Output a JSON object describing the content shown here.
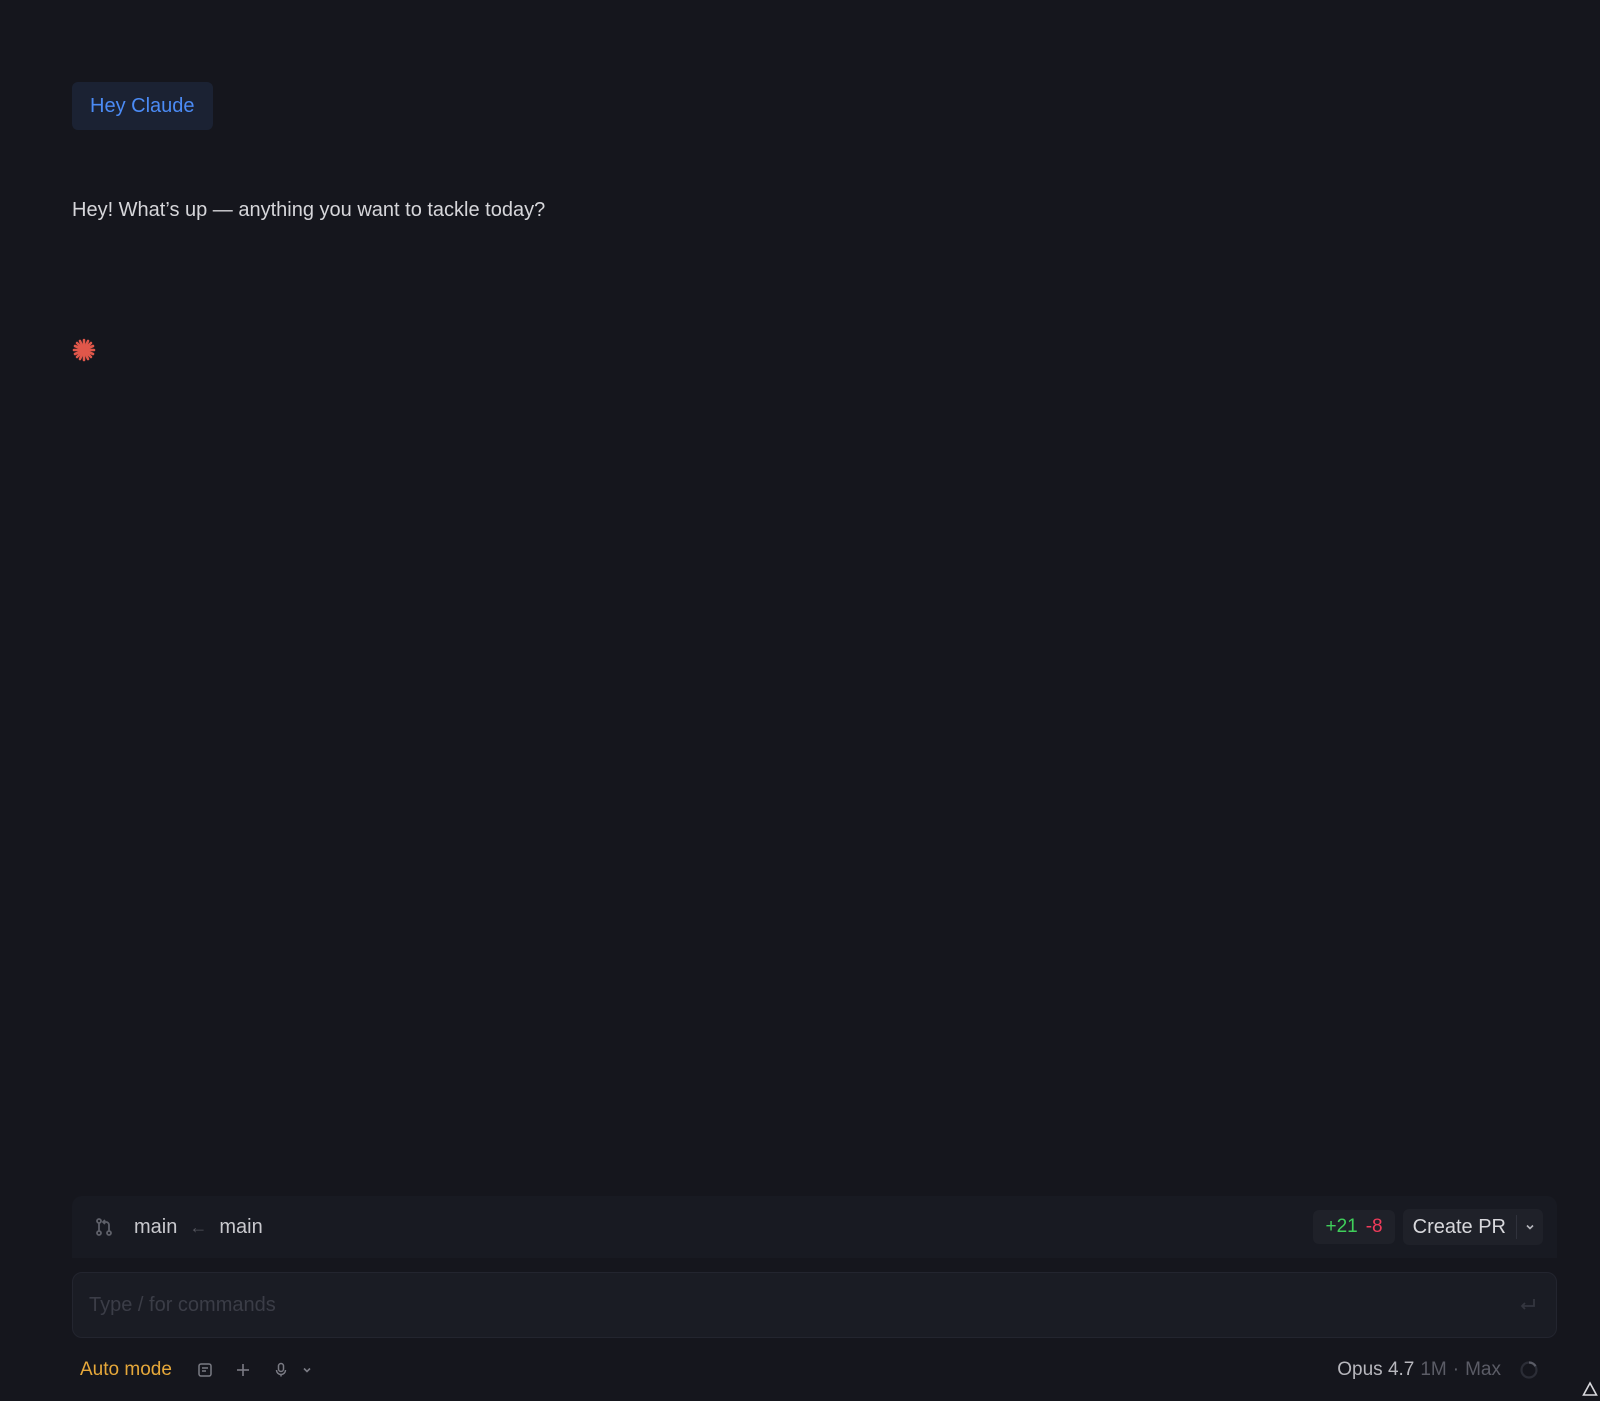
{
  "conversation": {
    "user_message": "Hey Claude",
    "assistant_message": "Hey! What’s up — anything you want to tackle today?"
  },
  "branch_bar": {
    "branch_icon": "git-pull-request-icon",
    "target_branch": "main",
    "arrow": "←",
    "source_branch": "main",
    "additions": "+21",
    "deletions": "-8",
    "create_pr_label": "Create PR"
  },
  "input": {
    "placeholder": "Type / for commands",
    "value": ""
  },
  "toolbar": {
    "mode_label": "Auto mode",
    "model_name": "Opus 4.7",
    "model_context": "1M",
    "separator": "·",
    "model_effort": "Max"
  },
  "colors": {
    "background": "#15161d",
    "user_text": "#4b8bf5",
    "accent_star": "#e0574a",
    "additions": "#3fcf5a",
    "deletions": "#ef3b5a",
    "auto_mode": "#e6a83a"
  }
}
